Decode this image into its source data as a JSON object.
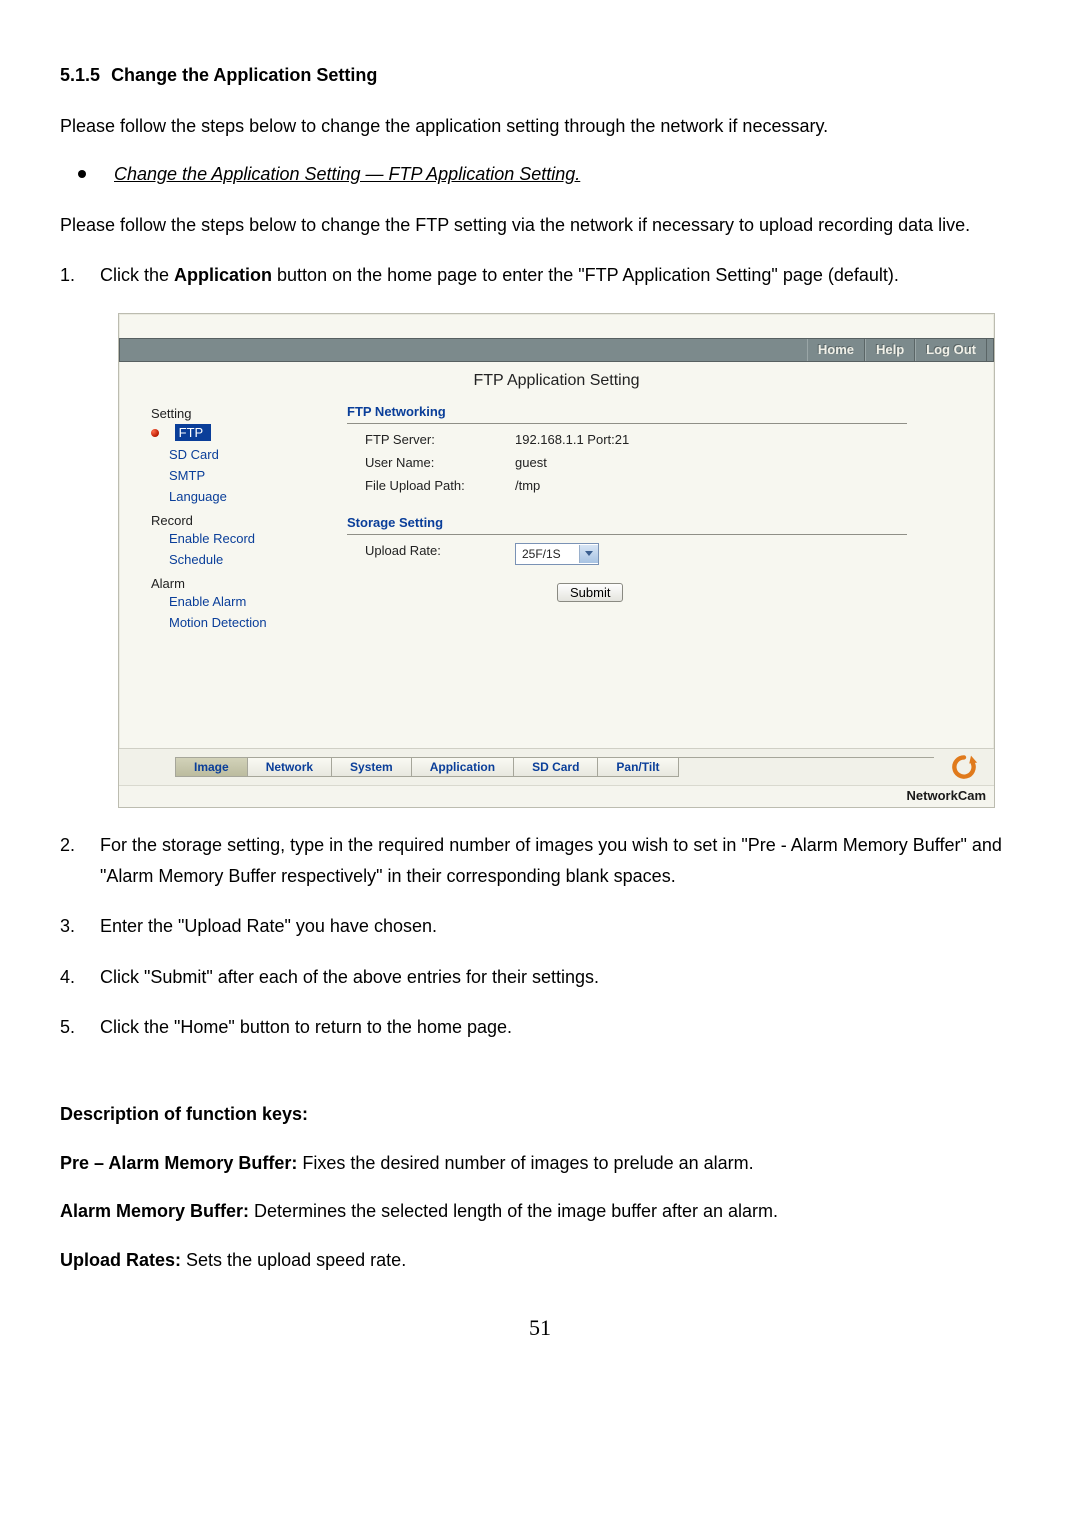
{
  "section": {
    "number": "5.1.5",
    "title": "Change the Application Setting"
  },
  "intro": "Please follow the steps below to change the application setting through the network if necessary.",
  "bullet": "Change the Application Setting — FTP Application Setting.",
  "intro2": "Please follow the steps below to change the FTP setting via the network if necessary to upload recording data live.",
  "steps": {
    "s1_a": "Click the ",
    "s1_bold": "Application",
    "s1_b": " button on the home page to enter the \"FTP Application Setting\" page (default).",
    "s2": "For the storage setting, type in the required number of images you wish to set in \"Pre - Alarm Memory Buffer\" and \"Alarm Memory Buffer respectively\" in their corresponding blank spaces.",
    "s3": "Enter the \"Upload Rate\" you have chosen.",
    "s4": "Click \"Submit\" after each of the above entries for their settings.",
    "s5": "Click the \"Home\" button to return to the home page."
  },
  "step_nums": {
    "n1": "1.",
    "n2": "2.",
    "n3": "3.",
    "n4": "4.",
    "n5": "5."
  },
  "desc": {
    "heading": "Description of function keys:",
    "k1_label": "Pre – Alarm Memory Buffer:",
    "k1_text": " Fixes the desired number of images to prelude an alarm.",
    "k2_label": "Alarm Memory Buffer:",
    "k2_text": " Determines the selected length of the image buffer after an alarm.",
    "k3_label": "Upload Rates:",
    "k3_text": " Sets the upload speed rate."
  },
  "page_number": "51",
  "screenshot": {
    "topbar": {
      "home": "Home",
      "help": "Help",
      "logout": "Log Out"
    },
    "title": "FTP Application Setting",
    "sidebar": {
      "setting": "Setting",
      "ftp": "FTP",
      "sdcard": "SD Card",
      "smtp": "SMTP",
      "language": "Language",
      "record": "Record",
      "enable_record": "Enable Record",
      "schedule": "Schedule",
      "alarm": "Alarm",
      "enable_alarm": "Enable Alarm",
      "motion": "Motion Detection"
    },
    "ftp_group": {
      "heading": "FTP Networking",
      "server_label": "FTP Server:",
      "server_value": "192.168.1.1 Port:21",
      "user_label": "User Name:",
      "user_value": "guest",
      "path_label": "File Upload Path:",
      "path_value": "/tmp"
    },
    "storage_group": {
      "heading": "Storage Setting",
      "rate_label": "Upload Rate:",
      "rate_value": "25F/1S",
      "submit": "Submit"
    },
    "tabs": {
      "image": "Image",
      "network": "Network",
      "system": "System",
      "application": "Application",
      "sdcard": "SD Card",
      "pantilt": "Pan/Tilt"
    },
    "brand": "NetworkCam"
  }
}
